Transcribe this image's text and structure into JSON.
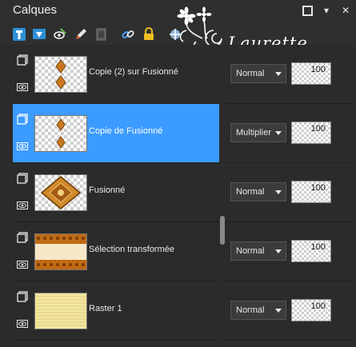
{
  "panel": {
    "title": "Calques"
  },
  "watermark": {
    "text": "Laurette"
  },
  "toolbar": {
    "tools": [
      "new-raster-layer-icon",
      "new-vector-layer-icon",
      "visibility-toggle-icon",
      "edit-icon",
      "layer-group-icon",
      "link-icon",
      "lock-icon",
      "mask-icon"
    ]
  },
  "layers": [
    {
      "name": "Copie (2) sur Fusionné",
      "blend": "Normal",
      "opacity": "100",
      "selected": false,
      "thumb": "orange-dots"
    },
    {
      "name": "Copie de Fusionné",
      "blend": "Multiplier",
      "opacity": "100",
      "selected": true,
      "thumb": "orange-dots"
    },
    {
      "name": "Fusionné",
      "blend": "Normal",
      "opacity": "100",
      "selected": false,
      "thumb": "diamond"
    },
    {
      "name": "Sélection transformée",
      "blend": "Normal",
      "opacity": "100",
      "selected": false,
      "thumb": "frame"
    },
    {
      "name": "Raster 1",
      "blend": "Normal",
      "opacity": "100",
      "selected": false,
      "thumb": "stripes"
    }
  ],
  "colors": {
    "selected": "#3c9bff",
    "panel": "#2b2b2b",
    "accent_orange": "#c8781e",
    "raster_yellow": "#f3e6a0"
  }
}
